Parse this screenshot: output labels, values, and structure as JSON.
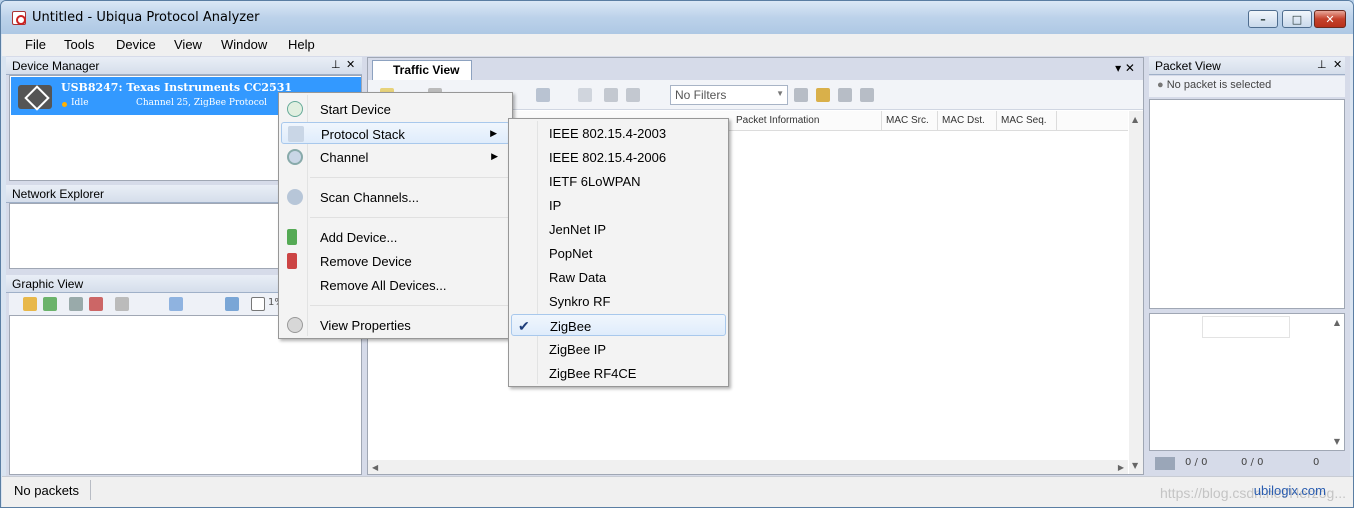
{
  "window": {
    "title": "Untitled - Ubiqua Protocol Analyzer",
    "controls": {
      "minimize": "–",
      "maximize": "□",
      "close": "✕"
    }
  },
  "menubar": [
    "File",
    "Tools",
    "Device",
    "View",
    "Window",
    "Help"
  ],
  "device_manager": {
    "title": "Device Manager",
    "device": {
      "name": "USB8247: Texas Instruments CC2531",
      "status": "Idle",
      "channel": "Channel 25, ZigBee Protocol"
    }
  },
  "network_explorer": {
    "title": "Network Explorer"
  },
  "graphic_view": {
    "title": "Graphic View",
    "zoom_fragment": "1%"
  },
  "traffic_view": {
    "tab_label": "Traffic View",
    "filter_placeholder": "No Filters",
    "columns": [
      "Packet Information",
      "MAC Src.",
      "MAC Dst.",
      "MAC Seq."
    ]
  },
  "packet_view": {
    "title": "Packet View",
    "status": "No packet is selected",
    "counters": [
      "0 / 0",
      "0 / 0",
      "0"
    ]
  },
  "context_menu": {
    "items": [
      {
        "label": "Start Device"
      },
      {
        "label": "Protocol Stack",
        "submenu": true
      },
      {
        "label": "Channel",
        "submenu": true
      },
      {
        "label": "Scan Channels..."
      },
      {
        "label": "Add Device..."
      },
      {
        "label": "Remove Device"
      },
      {
        "label": "Remove All Devices..."
      },
      {
        "label": "View Properties"
      }
    ]
  },
  "protocol_submenu": {
    "items": [
      "IEEE 802.15.4-2003",
      "IEEE 802.15.4-2006",
      "IETF 6LoWPAN",
      "IP",
      "JenNet IP",
      "PopNet",
      "Raw Data",
      "Synkro RF",
      "ZigBee",
      "ZigBee IP",
      "ZigBee RF4CE"
    ],
    "selected": "ZigBee"
  },
  "statusbar": {
    "text": "No packets",
    "brand": "ubilogix.com",
    "watermark": "https://blog.csdn.net/Herzog..."
  },
  "colors": {
    "selection": "#3399ff",
    "menu_highlight": "#dfecfb",
    "brand": "#2a5db0"
  }
}
